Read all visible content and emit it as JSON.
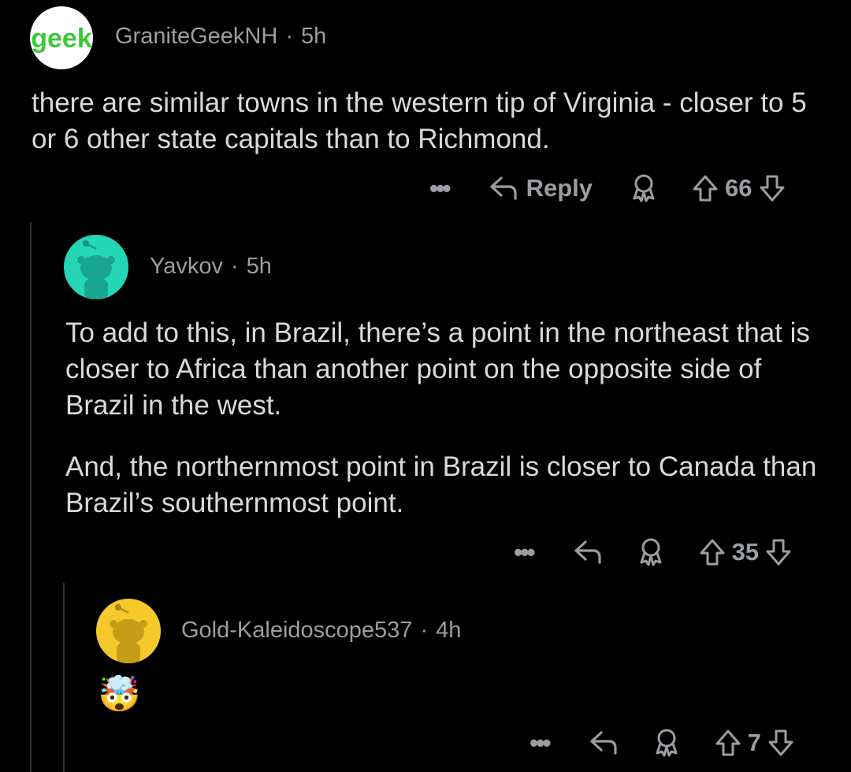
{
  "comments": [
    {
      "author": "GraniteGeekNH",
      "time": "5h",
      "avatar_text": "geek",
      "avatar_color": "#ffffff",
      "paragraphs": [
        "there are similar towns in the western tip of Virginia - closer to 5 or 6 other state capitals than to Richmond."
      ],
      "reply_label": "Reply",
      "score": "66"
    },
    {
      "author": "Yavkov",
      "time": "5h",
      "avatar_color": "#24d6b6",
      "paragraphs": [
        "To add to this, in Brazil, there’s a point in the northeast that is closer to Africa than another point on the opposite side of Brazil in the west.",
        "And, the northernmost point in Brazil is closer to Canada than Brazil’s southernmost point."
      ],
      "score": "35"
    },
    {
      "author": "Gold-Kaleidoscope537",
      "time": "4h",
      "avatar_color": "#f5c92b",
      "emoji": "🤯",
      "score": "7"
    }
  ],
  "separator": "·",
  "more_label": "•••",
  "icons": {
    "reply": "reply-arrow-icon",
    "award": "award-icon",
    "upvote": "upvote-arrow-icon",
    "downvote": "downvote-arrow-icon"
  },
  "colors": {
    "background": "#000000",
    "text": "#d7dadc",
    "meta": "#9a9da1",
    "geek_green": "#3cc83c"
  }
}
